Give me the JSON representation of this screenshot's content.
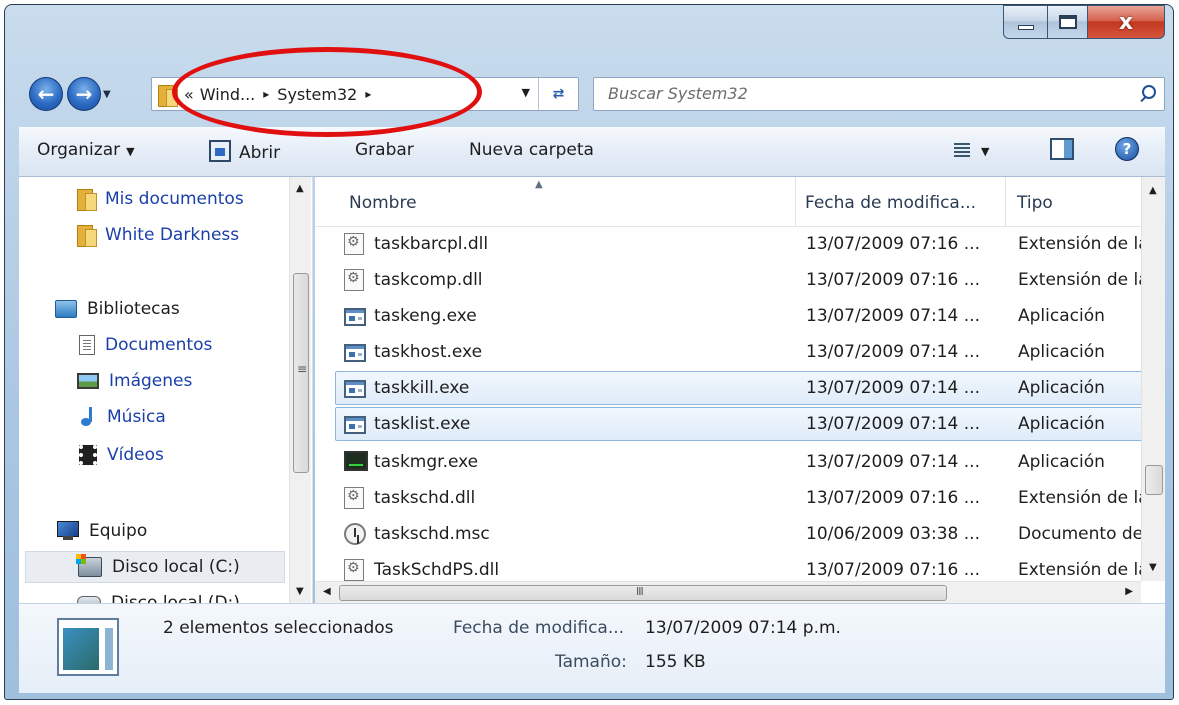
{
  "window": {
    "caption_buttons": {
      "minimize_icon": "minimize-icon",
      "maximize_icon": "maximize-icon",
      "close_label": "x"
    }
  },
  "navigation": {
    "back_icon": "back-arrow-icon",
    "forward_icon": "forward-arrow-icon",
    "address": {
      "overflow": "«",
      "crumbs": [
        "Wind...",
        "System32"
      ],
      "separator": "▸"
    },
    "search_placeholder": "Buscar System32"
  },
  "toolbar": {
    "organize_label": "Organizar",
    "open_label": "Abrir",
    "burn_label": "Grabar",
    "new_folder_label": "Nueva carpeta",
    "help_label": "?"
  },
  "sidebar": {
    "items": [
      {
        "label": "Mis documentos",
        "icon": "folder-icon"
      },
      {
        "label": "White Darkness",
        "icon": "folder-icon"
      },
      {
        "label": "Bibliotecas",
        "icon": "library-icon"
      },
      {
        "label": "Documentos",
        "icon": "document-icon"
      },
      {
        "label": "Imágenes",
        "icon": "pictures-icon"
      },
      {
        "label": "Música",
        "icon": "music-icon"
      },
      {
        "label": "Vídeos",
        "icon": "video-icon"
      },
      {
        "label": "Equipo",
        "icon": "computer-icon"
      },
      {
        "label": "Disco local (C:)",
        "icon": "drive-c-icon"
      },
      {
        "label": "Disco local (D:)",
        "icon": "drive-d-icon"
      }
    ]
  },
  "file_list": {
    "columns": [
      "Nombre",
      "Fecha de modifica...",
      "Tipo"
    ],
    "rows": [
      {
        "name": "taskbarcpl.dll",
        "date": "13/07/2009 07:16 ...",
        "type": "Extensión de la",
        "icon": "dll-icon",
        "selected": false
      },
      {
        "name": "taskcomp.dll",
        "date": "13/07/2009 07:16 ...",
        "type": "Extensión de la",
        "icon": "dll-icon",
        "selected": false
      },
      {
        "name": "taskeng.exe",
        "date": "13/07/2009 07:14 ...",
        "type": "Aplicación",
        "icon": "exe-icon",
        "selected": false
      },
      {
        "name": "taskhost.exe",
        "date": "13/07/2009 07:14 ...",
        "type": "Aplicación",
        "icon": "exe-icon",
        "selected": false
      },
      {
        "name": "taskkill.exe",
        "date": "13/07/2009 07:14 ...",
        "type": "Aplicación",
        "icon": "exe-icon",
        "selected": true
      },
      {
        "name": "tasklist.exe",
        "date": "13/07/2009 07:14 ...",
        "type": "Aplicación",
        "icon": "exe-icon",
        "selected": true
      },
      {
        "name": "taskmgr.exe",
        "date": "13/07/2009 07:14 ...",
        "type": "Aplicación",
        "icon": "task-manager-icon",
        "selected": false
      },
      {
        "name": "taskschd.dll",
        "date": "13/07/2009 07:16 ...",
        "type": "Extensión de la",
        "icon": "dll-icon",
        "selected": false
      },
      {
        "name": "taskschd.msc",
        "date": "10/06/2009 03:38 ...",
        "type": "Documento de",
        "icon": "scheduler-icon",
        "selected": false
      },
      {
        "name": "TaskSchdPS.dll",
        "date": "13/07/2009 07:16 ...",
        "type": "Extensión de la",
        "icon": "dll-icon",
        "selected": false
      }
    ],
    "hscroll_grip": "III"
  },
  "details": {
    "selection_text": "2 elementos seleccionados",
    "date_label": "Fecha de modifica...",
    "date_value": "13/07/2009 07:14 p.m.",
    "size_label": "Tamaño:",
    "size_value": "155 KB"
  },
  "colors": {
    "annotation": "#e01010",
    "selection": "#dfecf9",
    "link_blue": "#1a3fa8"
  }
}
